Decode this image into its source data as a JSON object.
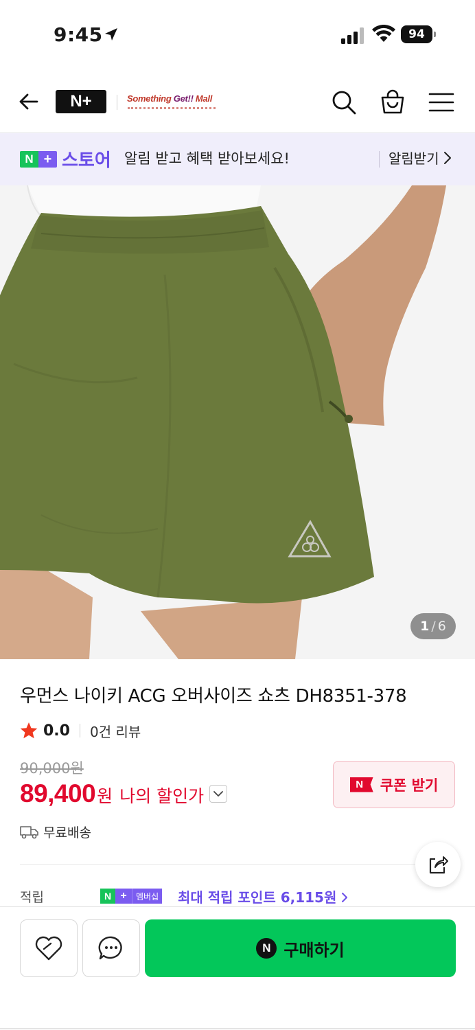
{
  "status_bar": {
    "time": "9:45",
    "battery": "94"
  },
  "header": {
    "brand_logo": "N+",
    "mall_logo_parts": [
      "Something ",
      "Get!!",
      " Mall"
    ],
    "icons": [
      "back-arrow-icon",
      "search-icon",
      "shopping-bag-icon",
      "menu-icon"
    ]
  },
  "store_banner": {
    "badge_n": "N",
    "badge_plus": "+",
    "store_name": "스토어",
    "message": "알림 받고 혜택 받아보세요!",
    "notify_label": "알림받기"
  },
  "image_gallery": {
    "current": "1",
    "separator": "/",
    "total": "6"
  },
  "product": {
    "title": "우먼스 나이키 ACG 오버사이즈 쇼츠 DH8351-378",
    "rating": "0.0",
    "review_count": "0건 리뷰",
    "original_price": "90,000원",
    "sale_price": "89,400",
    "sale_unit": "원",
    "my_price_label": "나의 할인가",
    "coupon_icon": "N",
    "coupon_label": "쿠폰 받기",
    "shipping": "무료배송"
  },
  "points": {
    "label": "적립",
    "badge_n": "N",
    "badge_plus": "+",
    "badge_text": "멤버십",
    "text": "최대 적립 포인트 6,115원"
  },
  "bottom_bar": {
    "buy_icon": "N",
    "buy_label": "구매하기"
  },
  "colors": {
    "naver_green": "#03c75a",
    "store_purple": "#6a4de8",
    "price_red": "#e1092e",
    "banner_bg": "#f0eefb",
    "product_olive": "#6b7a3c"
  }
}
